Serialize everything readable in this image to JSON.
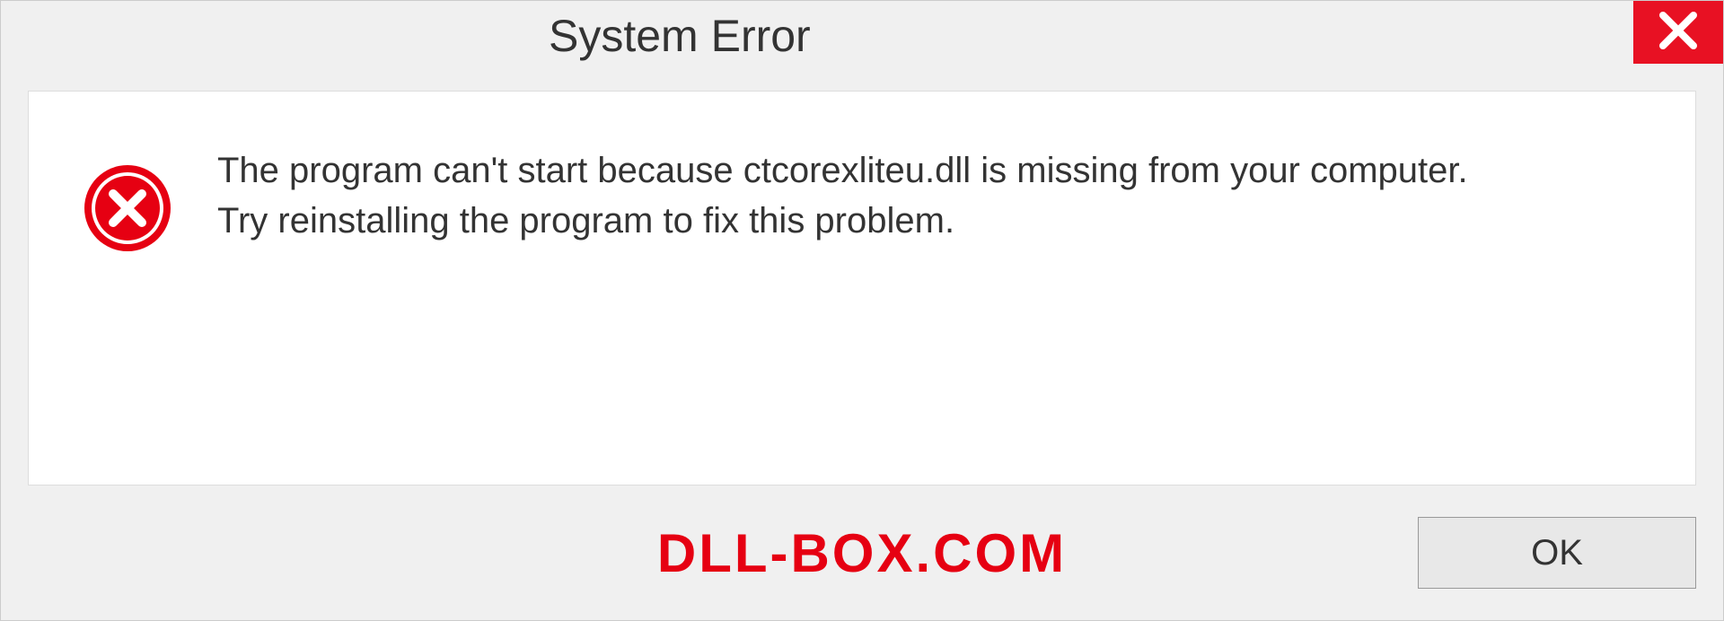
{
  "dialog": {
    "title": "System Error",
    "message": "The program can't start because ctcorexliteu.dll is missing from your computer. Try reinstalling the program to fix this problem.",
    "ok_label": "OK"
  },
  "watermark": "DLL-BOX.COM",
  "colors": {
    "close_red": "#e81123",
    "error_red": "#e60012",
    "accent_red": "#e60012"
  }
}
